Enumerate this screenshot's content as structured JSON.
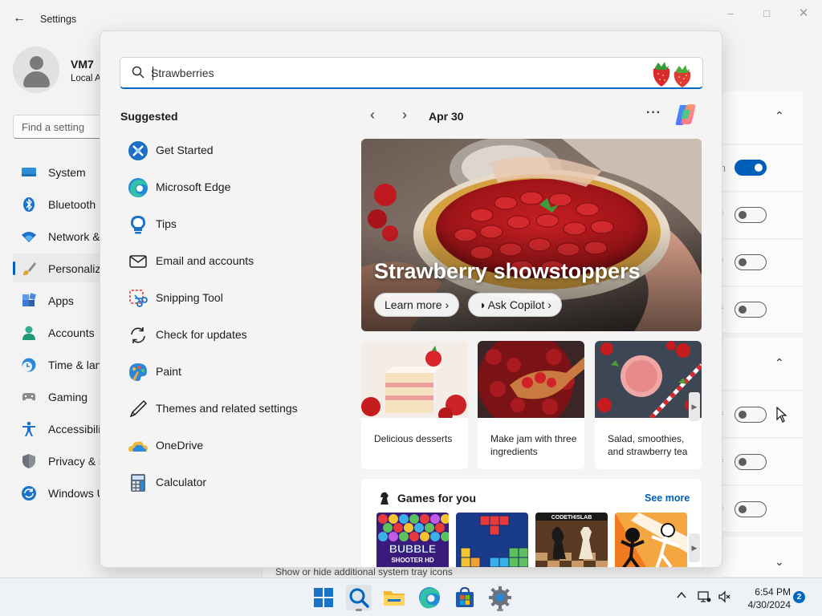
{
  "settings": {
    "title": "Settings",
    "user": {
      "name": "VM7",
      "account_type": "Local A"
    },
    "find_placeholder": "Find a setting",
    "nav": [
      {
        "label": "System",
        "icon": "system-icon"
      },
      {
        "label": "Bluetooth",
        "icon": "bluetooth-icon"
      },
      {
        "label": "Network &",
        "icon": "wifi-icon"
      },
      {
        "label": "Personaliz",
        "icon": "brush-icon",
        "active": true
      },
      {
        "label": "Apps",
        "icon": "apps-icon"
      },
      {
        "label": "Accounts",
        "icon": "accounts-icon"
      },
      {
        "label": "Time & lan",
        "icon": "clock-icon"
      },
      {
        "label": "Gaming",
        "icon": "gamepad-icon"
      },
      {
        "label": "Accessibili",
        "icon": "accessibility-icon"
      },
      {
        "label": "Privacy & s",
        "icon": "shield-icon"
      },
      {
        "label": "Windows U",
        "icon": "update-icon"
      }
    ],
    "right_panel": {
      "fragment_on": "n",
      "fragment_off": "f",
      "toggles": [
        true,
        false,
        false,
        false,
        false,
        false,
        false
      ]
    },
    "tray_hint": "Show or hide additional system tray icons"
  },
  "search": {
    "query": "Strawberries",
    "suggested_heading": "Suggested",
    "apps": [
      {
        "label": "Get Started",
        "icon": "get-started-icon"
      },
      {
        "label": "Microsoft Edge",
        "icon": "edge-icon"
      },
      {
        "label": "Tips",
        "icon": "tips-icon"
      },
      {
        "label": "Email and accounts",
        "icon": "mail-icon"
      },
      {
        "label": "Snipping Tool",
        "icon": "snipping-tool-icon"
      },
      {
        "label": "Check for updates",
        "icon": "refresh-icon"
      },
      {
        "label": "Paint",
        "icon": "paint-icon"
      },
      {
        "label": "Themes and related settings",
        "icon": "pen-icon"
      },
      {
        "label": "OneDrive",
        "icon": "onedrive-icon"
      },
      {
        "label": "Calculator",
        "icon": "calculator-icon"
      }
    ],
    "date": "Apr 30",
    "more_label": "···",
    "hero": {
      "title": "Strawberry showstoppers",
      "learn_more": "Learn more",
      "ask_copilot": "Ask Copilot"
    },
    "cards": [
      {
        "text": "Delicious desserts"
      },
      {
        "text": "Make jam with three ingredients"
      },
      {
        "text": "Salad, smoothies, and strawberry tea"
      }
    ],
    "games": {
      "title": "Games for you",
      "see_more": "See more",
      "tiles": [
        {
          "name": "bubble-shooter",
          "text_top": "BUBBLE",
          "text_bottom": "SHOOTER HD"
        },
        {
          "name": "block-puzzle"
        },
        {
          "name": "chess",
          "text_top": "CODETHISLAB"
        },
        {
          "name": "stickman-fight"
        }
      ]
    }
  },
  "taskbar": {
    "time": "6:54 PM",
    "date": "4/30/2024",
    "notification_count": "2",
    "accent": "#0067c0"
  }
}
